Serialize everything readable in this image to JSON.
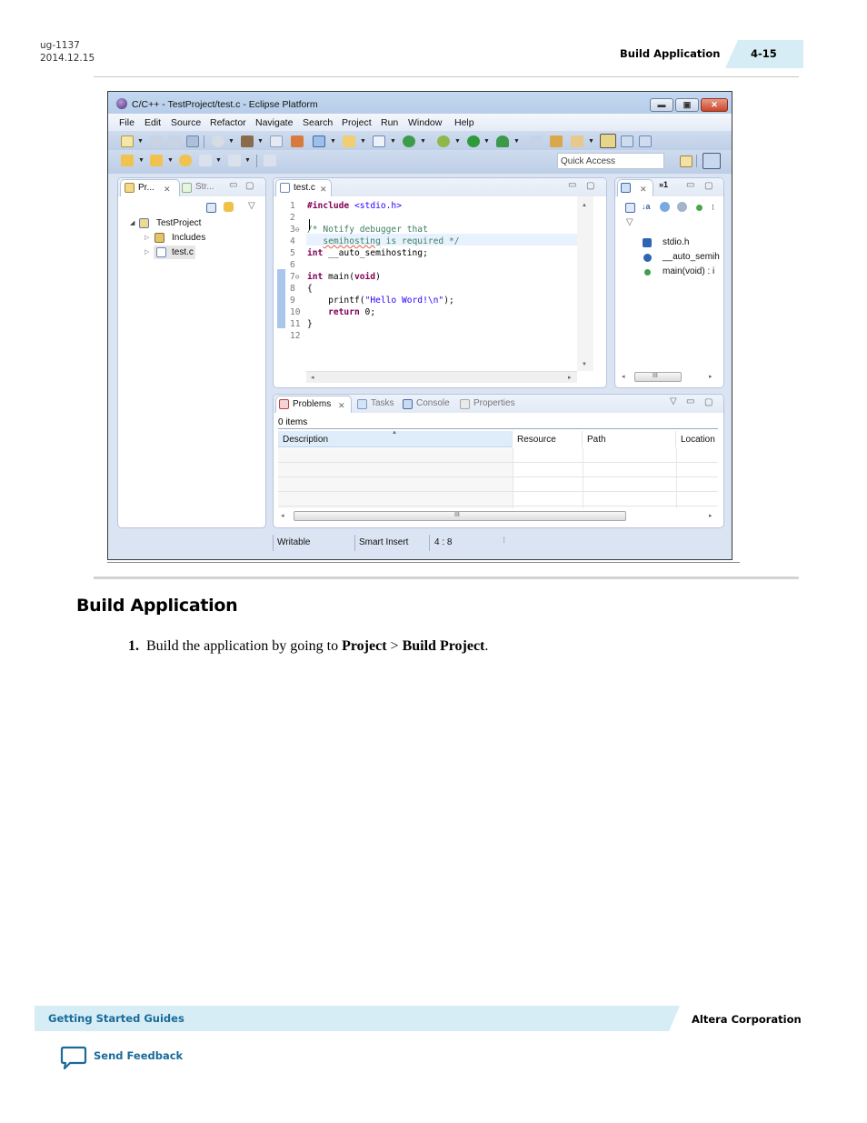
{
  "page_header": {
    "doc_id": "ug-1137",
    "doc_date": "2014.12.15",
    "section_title": "Build Application",
    "page_number": "4-15"
  },
  "eclipse": {
    "window_title": "C/C++ - TestProject/test.c - Eclipse Platform",
    "window_buttons": {
      "minimize": "▬",
      "maximize": "▣",
      "close": "✕"
    },
    "menu": [
      "File",
      "Edit",
      "Source",
      "Refactor",
      "Navigate",
      "Search",
      "Project",
      "Run",
      "Window",
      "Help"
    ],
    "quick_access_placeholder": "Quick Access",
    "project_explorer": {
      "tabs": [
        {
          "label": "Pr...",
          "icon": "project-explorer-icon",
          "active": true,
          "close": "✕"
        },
        {
          "label": "Str...",
          "icon": "structure-icon",
          "active": false
        }
      ],
      "tree": [
        {
          "label": "TestProject",
          "expander": "◢",
          "icon": "c-project-folder-icon",
          "level": 0
        },
        {
          "label": "Includes",
          "expander": "▷",
          "icon": "includes-icon",
          "level": 1
        },
        {
          "label": "test.c",
          "expander": "▷",
          "icon": "c-file-icon",
          "level": 1,
          "selected": true
        }
      ]
    },
    "editor": {
      "tab_label": "test.c",
      "tab_close": "✕",
      "lines": [
        {
          "n": "1",
          "fold": "",
          "text": "#include <stdio.h>"
        },
        {
          "n": "2",
          "fold": "",
          "text": ""
        },
        {
          "n": "3",
          "fold": "⊖",
          "text": "/* Notify debugger that"
        },
        {
          "n": "4",
          "fold": "",
          "text": "   semihosting is required */"
        },
        {
          "n": "5",
          "fold": "",
          "text": "int __auto_semihosting;"
        },
        {
          "n": "6",
          "fold": "",
          "text": ""
        },
        {
          "n": "7",
          "fold": "⊖",
          "text": "int main(void)"
        },
        {
          "n": "8",
          "fold": "",
          "text": "{"
        },
        {
          "n": "9",
          "fold": "",
          "text": "    printf(\"Hello Word!\\n\");"
        },
        {
          "n": "10",
          "fold": "",
          "text": "    return 0;"
        },
        {
          "n": "11",
          "fold": "",
          "text": "}"
        },
        {
          "n": "12",
          "fold": "",
          "text": ""
        }
      ],
      "code_tokens": {
        "l1_kw": "#include",
        "l1_rest": " <stdio.h>",
        "l3": "/* Notify debugger that",
        "l4_pre": "   ",
        "l4_word": "semihosting",
        "l4_rest": " is required */",
        "l5_kw": "int",
        "l5_rest": " __auto_semihosting;",
        "l7_kw": "int",
        "l7_rest1": " main(",
        "l7_kw2": "void",
        "l7_rest2": ")",
        "l8": "{",
        "l9_pre": "    printf(",
        "l9_str": "\"Hello Word!\\n\"",
        "l9_post": ");",
        "l10_pre": "    ",
        "l10_kw": "return",
        "l10_rest": " 0;",
        "l11": "}"
      }
    },
    "outline": {
      "more_tabs": "»1",
      "items": [
        {
          "label": "stdio.h",
          "icon": "include-icon"
        },
        {
          "label": "__auto_semih",
          "icon": "variable-icon"
        },
        {
          "label": "main(void) : i",
          "icon": "function-icon"
        }
      ],
      "scroll_grip": "III"
    },
    "problems": {
      "tabs": [
        {
          "label": "Problems",
          "active": true,
          "icon": "problems-icon",
          "close": "✕"
        },
        {
          "label": "Tasks",
          "active": false,
          "icon": "tasks-icon"
        },
        {
          "label": "Console",
          "active": false,
          "icon": "console-icon"
        },
        {
          "label": "Properties",
          "active": false,
          "icon": "properties-icon"
        }
      ],
      "count": "0 items",
      "columns": [
        "Description",
        "Resource",
        "Path",
        "Location"
      ],
      "sort_indicator": "▲",
      "rows": [],
      "scroll_grip": "III"
    },
    "status_bar": {
      "mode": "Writable",
      "insert_mode": "Smart Insert",
      "position": "4 : 8"
    }
  },
  "section": {
    "title": "Build Application",
    "step_number": "1.",
    "step_text_pre": "Build the application by going to ",
    "step_menu": "Project",
    "step_sep": " > ",
    "step_item": "Build Project",
    "step_end": "."
  },
  "footer": {
    "guide": "Getting Started Guides",
    "company": "Altera Corporation",
    "feedback": "Send Feedback"
  },
  "colors": {
    "accent_band": "#d6edf5",
    "link_blue": "#1a6a9a",
    "keyword": "#7f0055",
    "string": "#2a00ff",
    "comment": "#3f7f5f"
  }
}
